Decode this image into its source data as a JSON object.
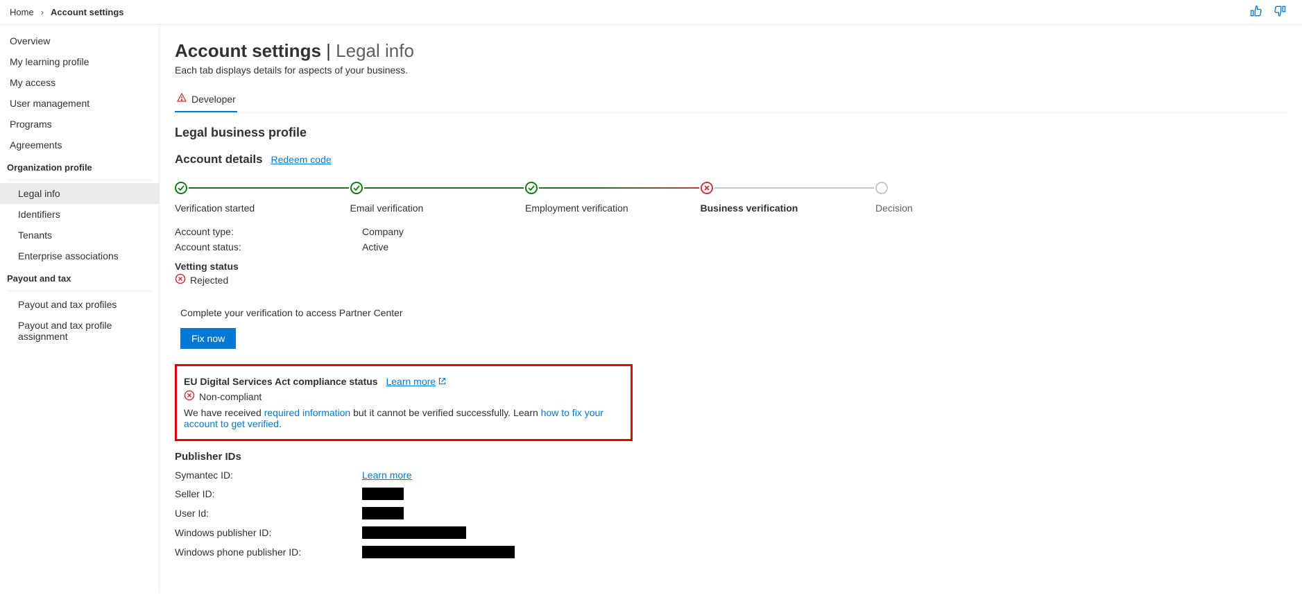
{
  "breadcrumb": {
    "home": "Home",
    "current": "Account settings"
  },
  "sidebar": {
    "top": [
      "Overview",
      "My learning profile",
      "My access",
      "User management",
      "Programs",
      "Agreements"
    ],
    "groups": [
      {
        "header": "Organization profile",
        "items": [
          "Legal info",
          "Identifiers",
          "Tenants",
          "Enterprise associations"
        ],
        "selectedIndex": 0
      },
      {
        "header": "Payout and tax",
        "items": [
          "Payout and tax profiles",
          "Payout and tax profile assignment"
        ]
      }
    ]
  },
  "page": {
    "title": "Account settings",
    "titleSub": "Legal info",
    "subtitle": "Each tab displays details for aspects of your business.",
    "tab": "Developer",
    "legalHeader": "Legal business profile",
    "accountDetails": "Account details",
    "redeem": "Redeem code"
  },
  "steps": [
    {
      "label": "Verification started",
      "status": "ok"
    },
    {
      "label": "Email verification",
      "status": "ok"
    },
    {
      "label": "Employment verification",
      "status": "ok"
    },
    {
      "label": "Business verification",
      "status": "fail",
      "bold": true
    },
    {
      "label": "Decision",
      "status": "pending"
    }
  ],
  "details": {
    "accountTypeLabel": "Account type:",
    "accountType": "Company",
    "accountStatusLabel": "Account status:",
    "accountStatus": "Active",
    "vettingLabel": "Vetting status",
    "vettingValue": "Rejected"
  },
  "complete": {
    "text": "Complete your verification to access Partner Center",
    "button": "Fix now"
  },
  "eu": {
    "title": "EU Digital Services Act compliance status",
    "learn": "Learn more",
    "status": "Non-compliant",
    "msgPre": "We have received ",
    "link1": "required information",
    "msgMid": " but it cannot be verified successfully. Learn ",
    "link2": "how to fix your account to get verified",
    "msgEnd": "."
  },
  "publisher": {
    "header": "Publisher IDs",
    "rows": [
      {
        "k": "Symantec ID:",
        "v": "link",
        "linkText": "Learn more"
      },
      {
        "k": "Seller ID:",
        "v": "redact",
        "w": "w60"
      },
      {
        "k": "User Id:",
        "v": "redact",
        "w": "w60"
      },
      {
        "k": "Windows publisher ID:",
        "v": "redact",
        "w": "w150"
      },
      {
        "k": "Windows phone publisher ID:",
        "v": "redact",
        "w": "w220"
      }
    ]
  }
}
